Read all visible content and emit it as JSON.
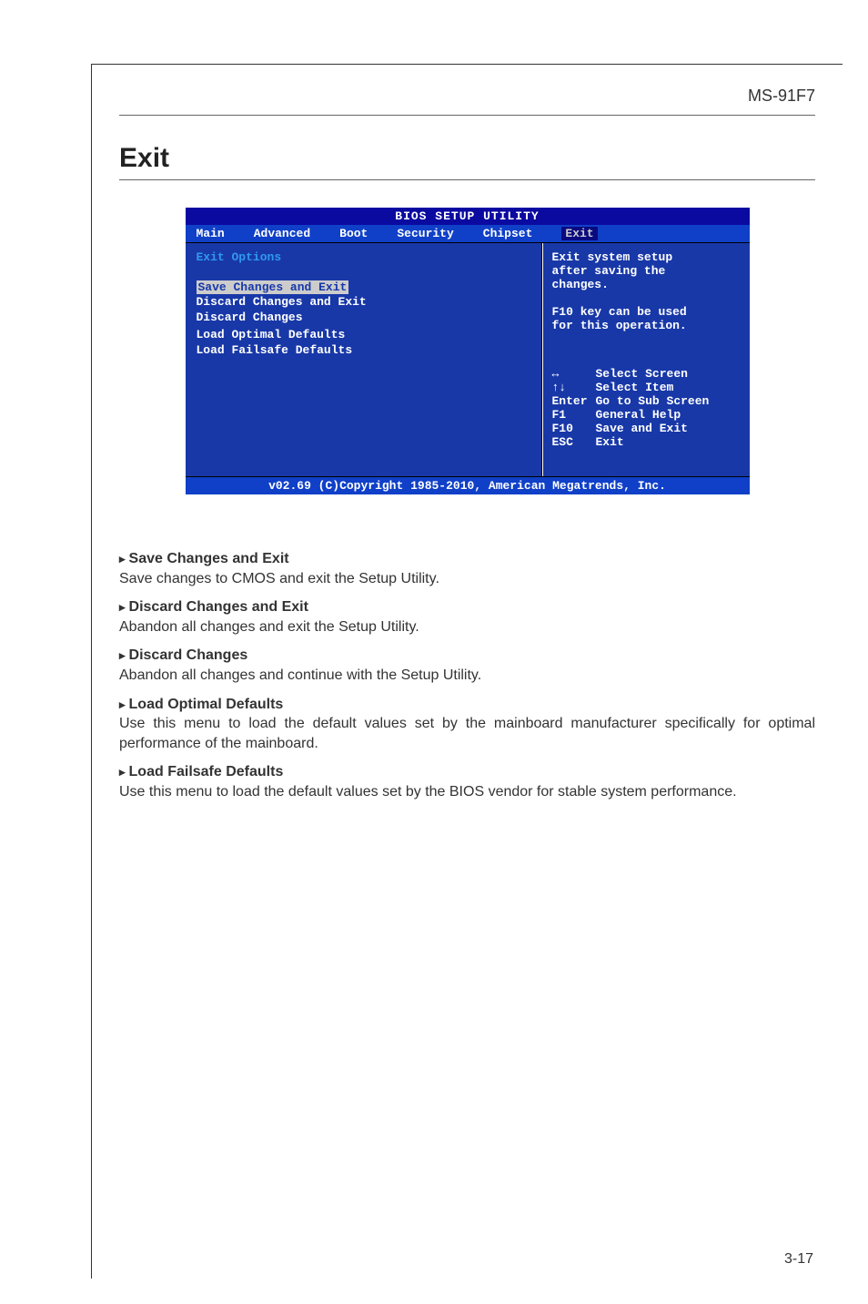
{
  "page": {
    "header": "MS-91F7",
    "heading": "Exit",
    "page_number": "3-17"
  },
  "bios": {
    "title": "BIOS SETUP UTILITY",
    "tabs": {
      "main": "Main",
      "advanced": "Advanced",
      "boot": "Boot",
      "security": "Security",
      "chipset": "Chipset",
      "exit": "Exit"
    },
    "left": {
      "heading": "Exit Options",
      "items": [
        "Save Changes and Exit",
        "Discard Changes and Exit",
        "Discard Changes",
        "",
        "Load Optimal Defaults",
        "Load Failsafe Defaults"
      ]
    },
    "right": {
      "desc1": "Exit system setup",
      "desc2": "after saving the",
      "desc3": "changes.",
      "desc4": "F10 key can be used",
      "desc5": "for this operation.",
      "keys": {
        "k1a": "↔",
        "k1b": "Select Screen",
        "k2a": "↑↓",
        "k2b": "Select Item",
        "k3a": "Enter",
        "k3b": "Go to Sub Screen",
        "k4a": "F1",
        "k4b": "General Help",
        "k5a": "F10",
        "k5b": "Save and Exit",
        "k6a": "ESC",
        "k6b": "Exit"
      }
    },
    "footer": "v02.69 (C)Copyright 1985-2010, American Megatrends, Inc."
  },
  "doc": {
    "h1": "Save Changes and Exit",
    "p1": "Save changes to CMOS and exit the Setup Utility.",
    "h2": "Discard Changes and Exit",
    "p2": "Abandon all changes and exit the Setup Utility.",
    "h3": "Discard Changes",
    "p3": "Abandon all changes and continue with the Setup Utility.",
    "h4": "Load Optimal Defaults",
    "p4": "Use this menu to load the default values set by the mainboard manufacturer specifically for optimal performance of the mainboard.",
    "h5": "Load Failsafe Defaults",
    "p5": "Use this menu to load the default values set by the BIOS vendor for stable system performance."
  }
}
